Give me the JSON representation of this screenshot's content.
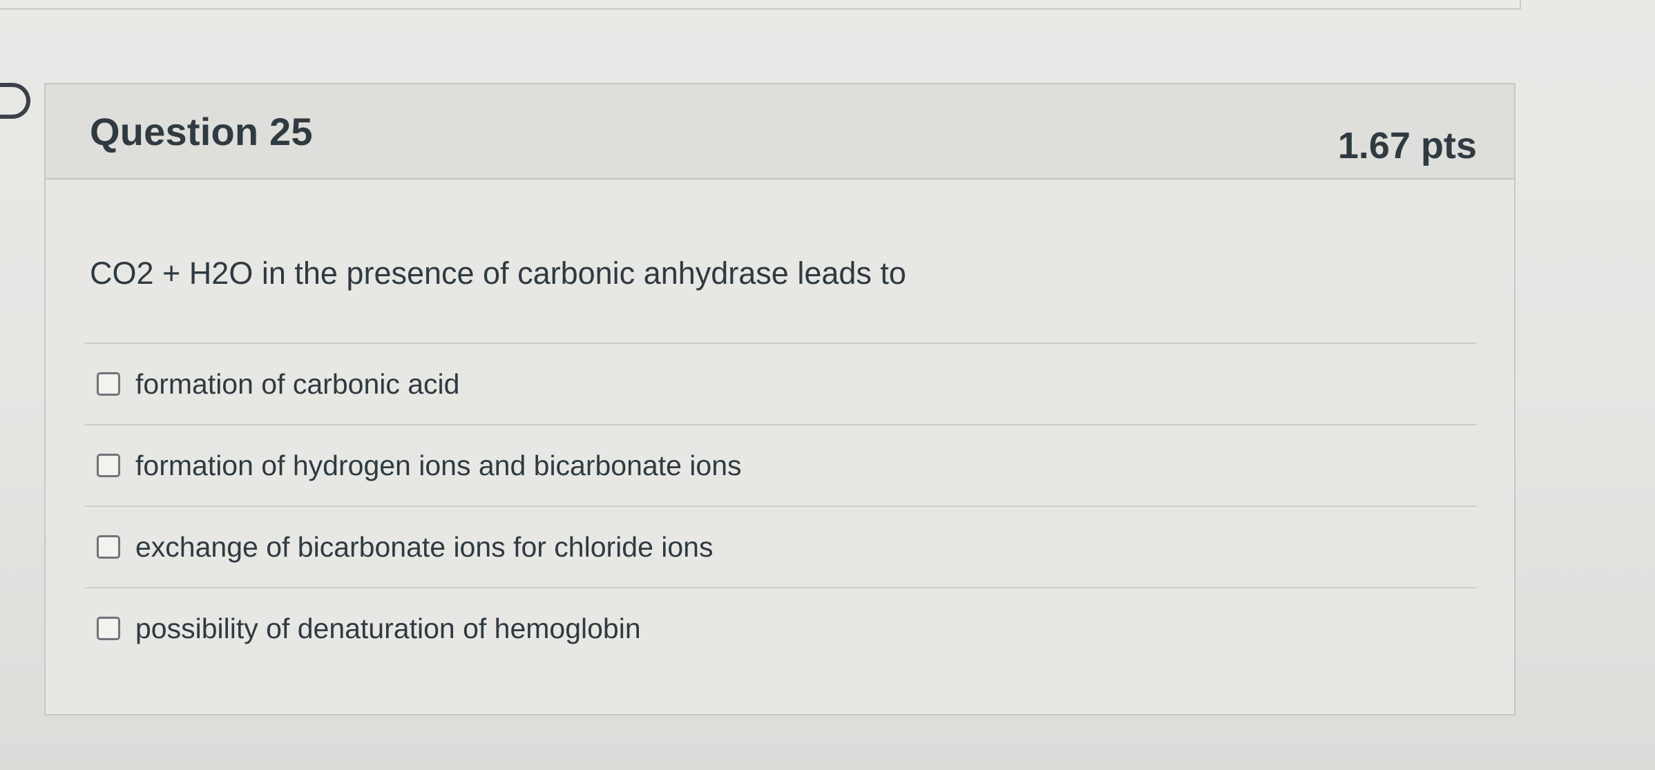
{
  "question": {
    "title": "Question 25",
    "points": "1.67 pts",
    "prompt": "CO2 + H2O in the presence of carbonic anhydrase leads to",
    "options": [
      {
        "label": "formation of carbonic acid"
      },
      {
        "label": "formation of hydrogen ions and bicarbonate ions"
      },
      {
        "label": "exchange of bicarbonate ions for chloride ions"
      },
      {
        "label": "possibility of denaturation of hemoglobin"
      }
    ]
  },
  "icons": {
    "flag": "bookmark-flag-icon",
    "checkbox": "checkbox-icon"
  },
  "colors": {
    "text": "#2f3a41",
    "background": "#e7e7e4",
    "header_background": "#dededb",
    "border": "#c7c7c4"
  }
}
